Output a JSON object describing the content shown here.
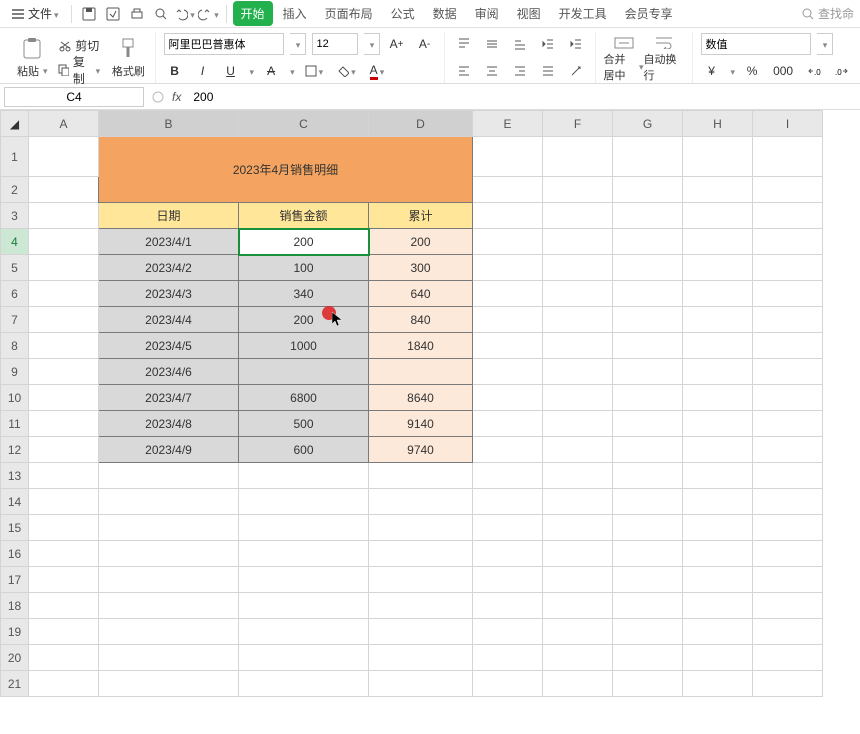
{
  "menubar": {
    "file_label": "文件",
    "tabs": [
      "开始",
      "插入",
      "页面布局",
      "公式",
      "数据",
      "审阅",
      "视图",
      "开发工具",
      "会员专享"
    ],
    "active_tab_index": 0,
    "search_placeholder": "查找命"
  },
  "ribbon": {
    "paste_label": "粘贴",
    "cut_label": "剪切",
    "copy_label": "复制",
    "format_painter_label": "格式刷",
    "font_name": "阿里巴巴普惠体",
    "font_size": "12",
    "font_buttons": {
      "bold": "B",
      "italic": "I",
      "underline": "U",
      "strike": "A"
    },
    "merge_label": "合并居中",
    "wrap_label": "自动换行",
    "num_format": "数值",
    "currency": "¥",
    "percent": "%",
    "comma": "000",
    "dec_dec": ".0",
    "inc_dec": ".00"
  },
  "namebox": {
    "active_cell": "C4",
    "fx": "fx",
    "formula": "200"
  },
  "columns": [
    "A",
    "B",
    "C",
    "D",
    "E",
    "F",
    "G",
    "H",
    "I"
  ],
  "title": "2023年4月销售明细",
  "headers": {
    "date": "日期",
    "amount": "销售金额",
    "cum": "累计"
  },
  "rows": [
    {
      "date": "2023/4/1",
      "amount": "200",
      "cum": "200"
    },
    {
      "date": "2023/4/2",
      "amount": "100",
      "cum": "300"
    },
    {
      "date": "2023/4/3",
      "amount": "340",
      "cum": "640"
    },
    {
      "date": "2023/4/4",
      "amount": "200",
      "cum": "840"
    },
    {
      "date": "2023/4/5",
      "amount": "1000",
      "cum": "1840"
    },
    {
      "date": "2023/4/6",
      "amount": "",
      "cum": ""
    },
    {
      "date": "2023/4/7",
      "amount": "6800",
      "cum": "8640"
    },
    {
      "date": "2023/4/8",
      "amount": "500",
      "cum": "9140"
    },
    {
      "date": "2023/4/9",
      "amount": "600",
      "cum": "9740"
    }
  ],
  "chart_data": {
    "type": "table",
    "title": "2023年4月销售明细",
    "columns": [
      "日期",
      "销售金额",
      "累计"
    ],
    "data": [
      [
        "2023/4/1",
        200,
        200
      ],
      [
        "2023/4/2",
        100,
        300
      ],
      [
        "2023/4/3",
        340,
        640
      ],
      [
        "2023/4/4",
        200,
        840
      ],
      [
        "2023/4/5",
        1000,
        1840
      ],
      [
        "2023/4/6",
        null,
        null
      ],
      [
        "2023/4/7",
        6800,
        8640
      ],
      [
        "2023/4/8",
        500,
        9140
      ],
      [
        "2023/4/9",
        600,
        9740
      ]
    ]
  }
}
